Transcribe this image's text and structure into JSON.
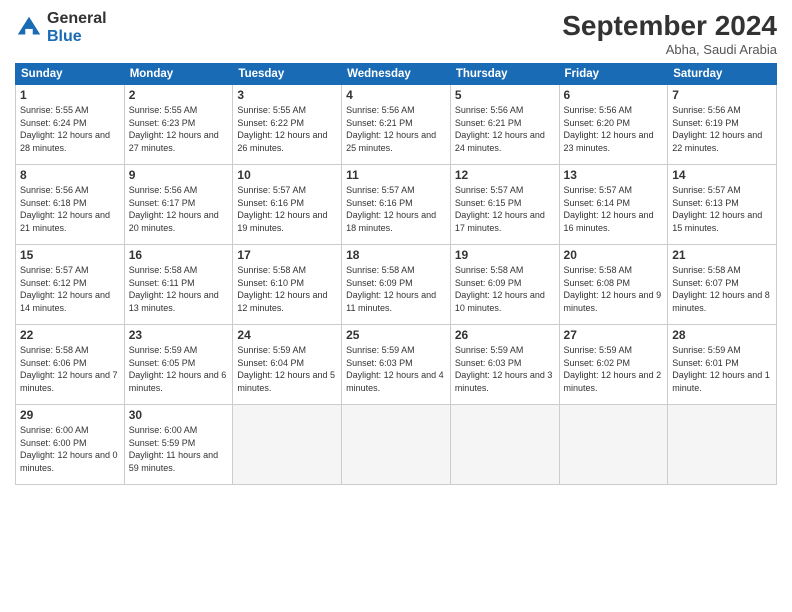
{
  "logo": {
    "general": "General",
    "blue": "Blue"
  },
  "header": {
    "month": "September 2024",
    "location": "Abha, Saudi Arabia"
  },
  "days": [
    "Sunday",
    "Monday",
    "Tuesday",
    "Wednesday",
    "Thursday",
    "Friday",
    "Saturday"
  ],
  "weeks": [
    [
      {
        "day": "1",
        "sunrise": "5:55 AM",
        "sunset": "6:24 PM",
        "daylight": "12 hours and 28 minutes."
      },
      {
        "day": "2",
        "sunrise": "5:55 AM",
        "sunset": "6:23 PM",
        "daylight": "12 hours and 27 minutes."
      },
      {
        "day": "3",
        "sunrise": "5:55 AM",
        "sunset": "6:22 PM",
        "daylight": "12 hours and 26 minutes."
      },
      {
        "day": "4",
        "sunrise": "5:56 AM",
        "sunset": "6:21 PM",
        "daylight": "12 hours and 25 minutes."
      },
      {
        "day": "5",
        "sunrise": "5:56 AM",
        "sunset": "6:21 PM",
        "daylight": "12 hours and 24 minutes."
      },
      {
        "day": "6",
        "sunrise": "5:56 AM",
        "sunset": "6:20 PM",
        "daylight": "12 hours and 23 minutes."
      },
      {
        "day": "7",
        "sunrise": "5:56 AM",
        "sunset": "6:19 PM",
        "daylight": "12 hours and 22 minutes."
      }
    ],
    [
      {
        "day": "8",
        "sunrise": "5:56 AM",
        "sunset": "6:18 PM",
        "daylight": "12 hours and 21 minutes."
      },
      {
        "day": "9",
        "sunrise": "5:56 AM",
        "sunset": "6:17 PM",
        "daylight": "12 hours and 20 minutes."
      },
      {
        "day": "10",
        "sunrise": "5:57 AM",
        "sunset": "6:16 PM",
        "daylight": "12 hours and 19 minutes."
      },
      {
        "day": "11",
        "sunrise": "5:57 AM",
        "sunset": "6:16 PM",
        "daylight": "12 hours and 18 minutes."
      },
      {
        "day": "12",
        "sunrise": "5:57 AM",
        "sunset": "6:15 PM",
        "daylight": "12 hours and 17 minutes."
      },
      {
        "day": "13",
        "sunrise": "5:57 AM",
        "sunset": "6:14 PM",
        "daylight": "12 hours and 16 minutes."
      },
      {
        "day": "14",
        "sunrise": "5:57 AM",
        "sunset": "6:13 PM",
        "daylight": "12 hours and 15 minutes."
      }
    ],
    [
      {
        "day": "15",
        "sunrise": "5:57 AM",
        "sunset": "6:12 PM",
        "daylight": "12 hours and 14 minutes."
      },
      {
        "day": "16",
        "sunrise": "5:58 AM",
        "sunset": "6:11 PM",
        "daylight": "12 hours and 13 minutes."
      },
      {
        "day": "17",
        "sunrise": "5:58 AM",
        "sunset": "6:10 PM",
        "daylight": "12 hours and 12 minutes."
      },
      {
        "day": "18",
        "sunrise": "5:58 AM",
        "sunset": "6:09 PM",
        "daylight": "12 hours and 11 minutes."
      },
      {
        "day": "19",
        "sunrise": "5:58 AM",
        "sunset": "6:09 PM",
        "daylight": "12 hours and 10 minutes."
      },
      {
        "day": "20",
        "sunrise": "5:58 AM",
        "sunset": "6:08 PM",
        "daylight": "12 hours and 9 minutes."
      },
      {
        "day": "21",
        "sunrise": "5:58 AM",
        "sunset": "6:07 PM",
        "daylight": "12 hours and 8 minutes."
      }
    ],
    [
      {
        "day": "22",
        "sunrise": "5:58 AM",
        "sunset": "6:06 PM",
        "daylight": "12 hours and 7 minutes."
      },
      {
        "day": "23",
        "sunrise": "5:59 AM",
        "sunset": "6:05 PM",
        "daylight": "12 hours and 6 minutes."
      },
      {
        "day": "24",
        "sunrise": "5:59 AM",
        "sunset": "6:04 PM",
        "daylight": "12 hours and 5 minutes."
      },
      {
        "day": "25",
        "sunrise": "5:59 AM",
        "sunset": "6:03 PM",
        "daylight": "12 hours and 4 minutes."
      },
      {
        "day": "26",
        "sunrise": "5:59 AM",
        "sunset": "6:03 PM",
        "daylight": "12 hours and 3 minutes."
      },
      {
        "day": "27",
        "sunrise": "5:59 AM",
        "sunset": "6:02 PM",
        "daylight": "12 hours and 2 minutes."
      },
      {
        "day": "28",
        "sunrise": "5:59 AM",
        "sunset": "6:01 PM",
        "daylight": "12 hours and 1 minute."
      }
    ],
    [
      {
        "day": "29",
        "sunrise": "6:00 AM",
        "sunset": "6:00 PM",
        "daylight": "12 hours and 0 minutes."
      },
      {
        "day": "30",
        "sunrise": "6:00 AM",
        "sunset": "5:59 PM",
        "daylight": "11 hours and 59 minutes."
      },
      null,
      null,
      null,
      null,
      null
    ]
  ]
}
